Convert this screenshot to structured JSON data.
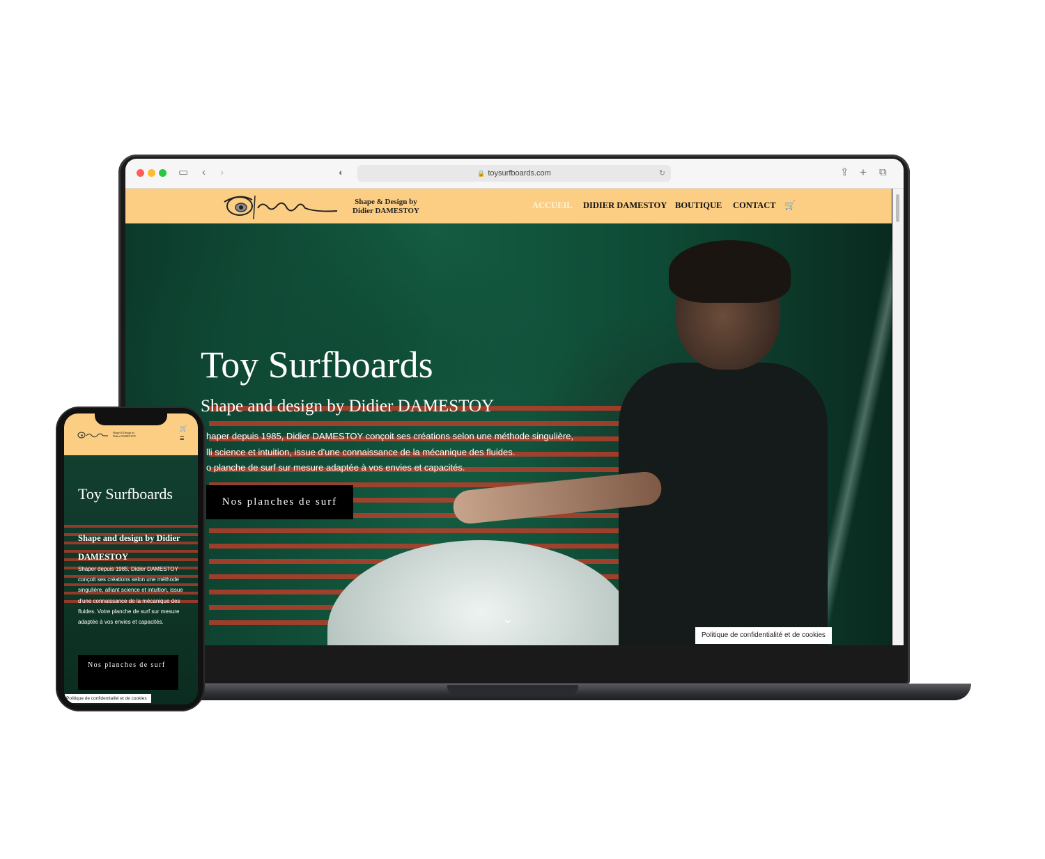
{
  "browser": {
    "url": "toysurfboards.com"
  },
  "header": {
    "tagline_line1": "Shape & Design by",
    "tagline_line2": "Didier DAMESTOY",
    "nav": [
      {
        "label": "ACCUEIL"
      },
      {
        "label": "DIDIER DAMESTOY"
      },
      {
        "label": "BOUTIQUE"
      },
      {
        "label": "CONTACT"
      }
    ]
  },
  "hero": {
    "title": "Toy Surfboards",
    "subtitle": "Shape and design by Didier DAMESTOY",
    "text_lines": [
      "haper depuis 1985, Didier DAMESTOY conçoit ses créations selon une méthode singulière,",
      "lli  science et intuition, issue d'une connaissance de la mécanique des fluides.",
      "o  planche de surf sur mesure adaptée à vos envies et capacités."
    ],
    "button": "Nos planches de surf"
  },
  "privacy": "Politique de confidentialité et de cookies",
  "mobile": {
    "tagline": "Shape & Design by Didier DAMESTOY",
    "title": "Toy Surfboards",
    "subtitle": "Shape and design by Didier DAMESTOY",
    "text": "Shaper depuis 1985, Didier DAMESTOY conçoit ses créations selon une méthode singulière, alliant science et intuition, issue d'une connaissance de la mécanique des fluides. Votre planche de surf sur mesure adaptée à vos envies et capacités.",
    "button": "Nos planches de surf",
    "privacy": "Politique de confidentialité et de cookies"
  },
  "colors": {
    "header_bg": "#fcce84",
    "button_bg": "#000000",
    "hero_green": "#145c42"
  }
}
